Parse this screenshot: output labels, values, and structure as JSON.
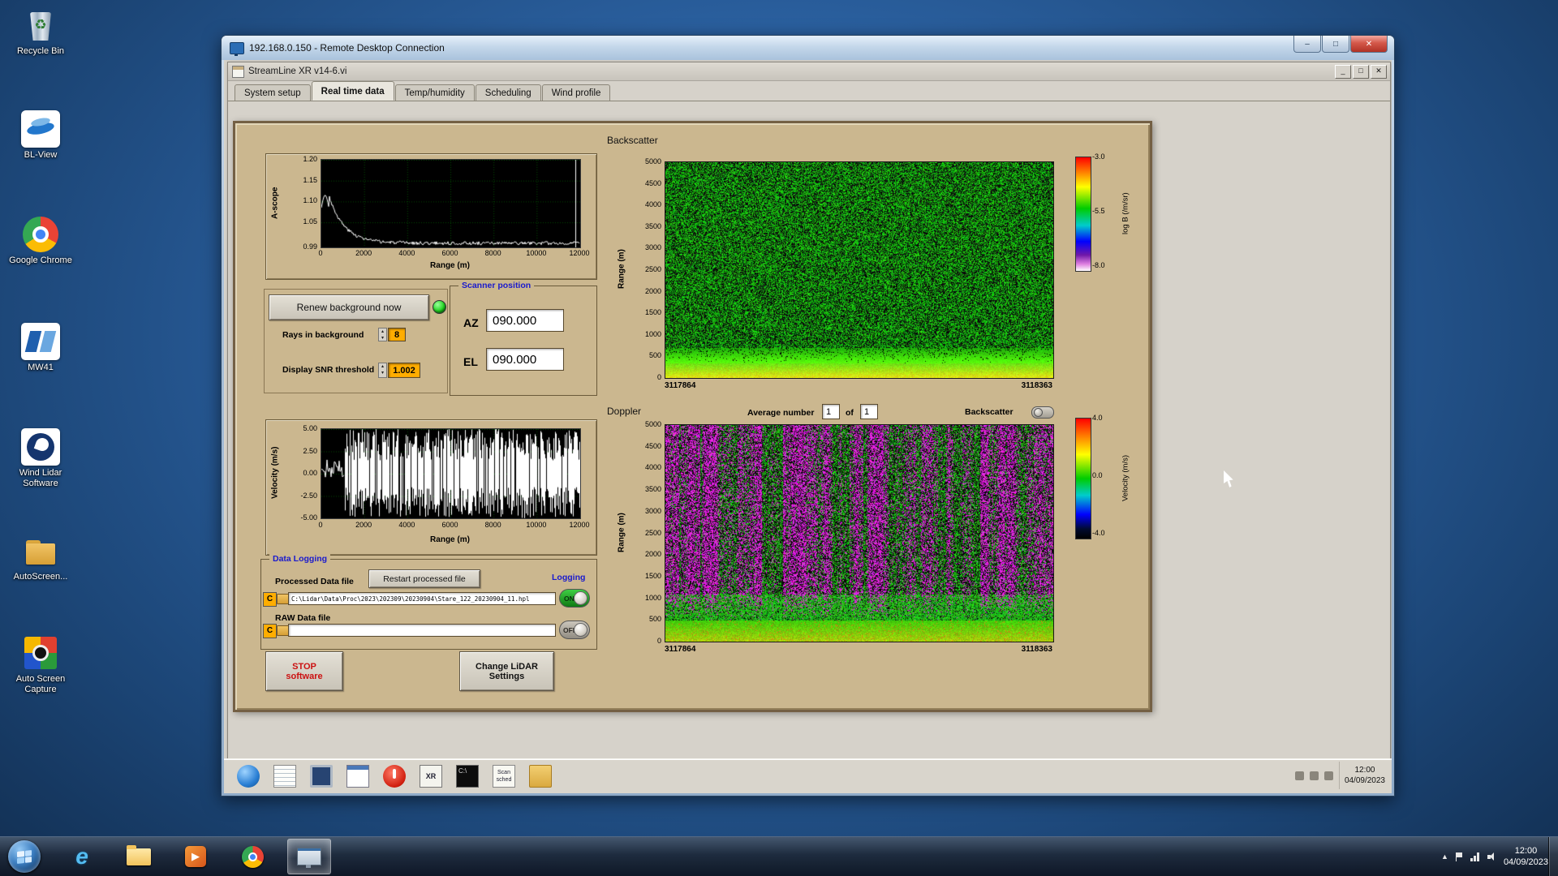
{
  "desktop": {
    "icons": [
      {
        "name": "recycle-bin",
        "label": "Recycle Bin"
      },
      {
        "name": "bl-view",
        "label": "BL-View"
      },
      {
        "name": "google-chrome",
        "label": "Google Chrome"
      },
      {
        "name": "mw41",
        "label": "MW41"
      },
      {
        "name": "wind-lidar",
        "label": "Wind Lidar Software"
      },
      {
        "name": "autoscreen-folder",
        "label": "AutoScreen..."
      },
      {
        "name": "auto-screen-capture",
        "label": "Auto Screen Capture"
      }
    ]
  },
  "rdp": {
    "title": "192.168.0.150 - Remote Desktop Connection"
  },
  "app": {
    "title": "StreamLine XR v14-6.vi",
    "tabs": [
      "System setup",
      "Real time data",
      "Temp/humidity",
      "Scheduling",
      "Wind profile"
    ],
    "active_tab": "Real time data"
  },
  "controls": {
    "backscatter_title": "Backscatter",
    "doppler_title": "Doppler",
    "renew_button": "Renew background now",
    "rays_label": "Rays in background",
    "rays_value": "8",
    "snr_label": "Display SNR threshold",
    "snr_value": "1.002",
    "scanner_group": "Scanner position",
    "az_label": "AZ",
    "az_value": "090.000",
    "el_label": "EL",
    "el_value": "090.000",
    "average_label": "Average number",
    "average_value": "1",
    "of_label": "of",
    "average_total": "1",
    "backscatter_toggle_label": "Backscatter",
    "stop_line1": "STOP",
    "stop_line2": "software",
    "change_line1": "Change LiDAR",
    "change_line2": "Settings"
  },
  "logging": {
    "group_title": "Data Logging",
    "processed_label": "Processed Data file",
    "restart_button": "Restart processed file",
    "logging_label": "Logging",
    "drive_button": "C",
    "processed_path": "C:\\Lidar\\Data\\Proc\\2023\\202309\\20230904\\Stare_122_20230904_11.hpl",
    "on_label": "ON",
    "raw_label": "RAW Data file",
    "raw_path": "",
    "off_label": "OFF"
  },
  "chart_data": {
    "ascope": {
      "type": "line",
      "ylabel": "A-scope",
      "xlabel": "Range (m)",
      "yticks": [
        "1.20",
        "1.15",
        "1.10",
        "1.05",
        "0.99"
      ],
      "ytick_fr": [
        0,
        0.238,
        0.476,
        0.714,
        1
      ],
      "xticks": [
        "0",
        "2000",
        "4000",
        "6000",
        "8000",
        "10000",
        "12000"
      ],
      "xlim": [
        0,
        12000
      ],
      "ylim": [
        0.99,
        1.2
      ],
      "description": "White trace peaks near 1.12 around 400 m then decays to a ~1.00 noise floor out to 12000 m; vertical cursor line near 11800 m"
    },
    "backscatter": {
      "type": "heatmap",
      "title": "Backscatter",
      "ylabel": "Range (m)",
      "yticks": [
        "5000",
        "4500",
        "4000",
        "3500",
        "3000",
        "2500",
        "2000",
        "1500",
        "1000",
        "500",
        "0"
      ],
      "x_start": "3117864",
      "x_end": "3118363",
      "colorbar": {
        "label": "log B (/m/sr)",
        "ticks": [
          "-3.0",
          "-5.5",
          "-8.0"
        ]
      },
      "description": "Green speckle noise field with bright yellow-green band below ~500 m"
    },
    "velocity": {
      "type": "line",
      "ylabel": "Velocity (m/s)",
      "xlabel": "Range (m)",
      "yticks": [
        "5.00",
        "2.50",
        "0.00",
        "-2.50",
        "-5.00"
      ],
      "xticks": [
        "0",
        "2000",
        "4000",
        "6000",
        "8000",
        "10000",
        "12000"
      ],
      "xlim": [
        0,
        12000
      ],
      "ylim": [
        -5,
        5
      ],
      "description": "Coherent trace near 0 m/s at short range, dense full-scale noise bars beyond ~1000 m"
    },
    "doppler": {
      "type": "heatmap",
      "title": "Doppler",
      "ylabel": "Range (m)",
      "yticks": [
        "5000",
        "4500",
        "4000",
        "3500",
        "3000",
        "2500",
        "2000",
        "1500",
        "1000",
        "500",
        "0"
      ],
      "x_start": "3117864",
      "x_end": "3118363",
      "colorbar": {
        "label": "Velocity (m/s)",
        "ticks": [
          "4.0",
          "0.0",
          "-4.0"
        ]
      },
      "description": "Magenta/green vertical streak noise with green-orange band below ~1000 m"
    }
  },
  "remote_taskbar": {
    "icons": [
      {
        "name": "ie-icon"
      },
      {
        "name": "document-icon"
      },
      {
        "name": "monitor-icon"
      },
      {
        "name": "image-viewer-icon"
      },
      {
        "name": "power-icon"
      },
      {
        "name": "xr-app-icon",
        "label": "XR"
      },
      {
        "name": "terminal-icon",
        "label": "C:\\"
      },
      {
        "name": "scan-sched-icon",
        "label": "Scan sched"
      },
      {
        "name": "folder-icon"
      }
    ],
    "clock_time": "12:00",
    "clock_date": "04/09/2023"
  },
  "taskbar": {
    "items": [
      {
        "name": "ie-taskbar-icon"
      },
      {
        "name": "explorer-taskbar-icon"
      },
      {
        "name": "media-player-taskbar-icon"
      },
      {
        "name": "chrome-taskbar-icon"
      },
      {
        "name": "rdp-taskbar-icon",
        "active": true
      }
    ],
    "clock_time": "12:00",
    "clock_date": "04/09/2023"
  }
}
